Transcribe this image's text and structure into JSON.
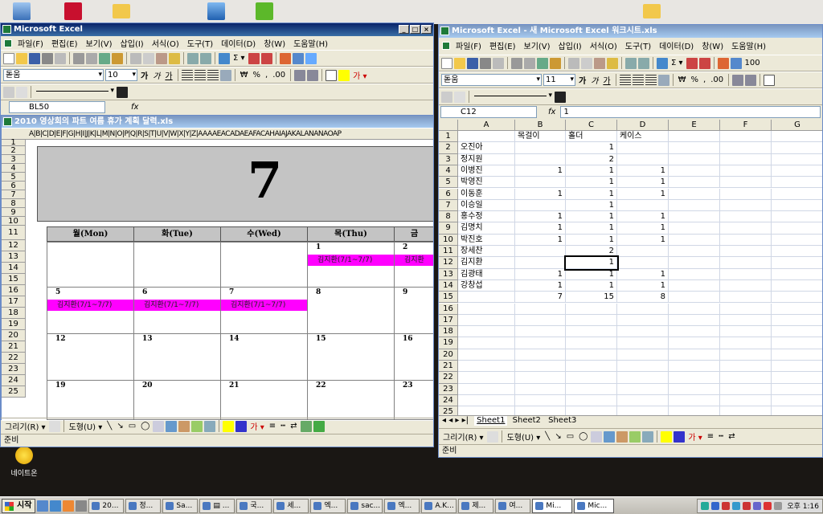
{
  "left_window": {
    "title": "Microsoft Excel",
    "menu": [
      "파일(F)",
      "편집(E)",
      "보기(V)",
      "삽입(I)",
      "서식(O)",
      "도구(T)",
      "데이터(D)",
      "창(W)",
      "도움말(H)"
    ],
    "font_name": "돋움",
    "font_size": "10",
    "name_box": "BL50",
    "fx": "fx",
    "workbook_title": "2010 영상회의 파트 여름 휴가 계획 달력.xls",
    "col_headers": [
      "A",
      "B",
      "C",
      "D",
      "E",
      "F",
      "G",
      "H",
      "I",
      "J",
      "K",
      "L",
      "M",
      "N",
      "O",
      "P",
      "Q",
      "R",
      "S",
      "T",
      "U",
      "V",
      "W",
      "X",
      "Y",
      "Z",
      "AAAAEACADAEAFACAHAIAJAKALANANAOAP"
    ],
    "row_numbers": [
      "1",
      "2",
      "3",
      "4",
      "5",
      "6",
      "7",
      "8",
      "9",
      "10",
      "11",
      "12",
      "13",
      "14",
      "15",
      "16",
      "17",
      "18",
      "19",
      "20",
      "21",
      "22",
      "23",
      "24",
      "25"
    ],
    "calendar": {
      "month": "7",
      "days": [
        "월(Mon)",
        "화(Tue)",
        "수(Wed)",
        "목(Thu)",
        "금"
      ],
      "week1": [
        "",
        "",
        "",
        "1",
        "2"
      ],
      "week2": [
        "5",
        "6",
        "7",
        "8",
        "9"
      ],
      "week3": [
        "12",
        "13",
        "14",
        "15",
        "16"
      ],
      "week4": [
        "19",
        "20",
        "21",
        "22",
        "23"
      ],
      "event_label": "김지환(7/1~7/7)",
      "event_label_short": "김지환"
    },
    "drawing_label": "그리기(R) ▾",
    "shapes_label": "도형(U) ▾",
    "status": "준비"
  },
  "right_window": {
    "title": "Microsoft Excel - 새 Microsoft Excel 워크시트.xls",
    "menu": [
      "파일(F)",
      "편집(E)",
      "보기(V)",
      "삽입(I)",
      "서식(O)",
      "도구(T)",
      "데이터(D)",
      "창(W)",
      "도움말(H)"
    ],
    "font_name": "돋움",
    "font_size": "11",
    "zoom": "100",
    "name_box": "C12",
    "fx": "fx",
    "formula_value": "1",
    "col_headers": [
      "A",
      "B",
      "C",
      "D",
      "E",
      "F",
      "G"
    ],
    "row_numbers": [
      "1",
      "2",
      "3",
      "4",
      "5",
      "6",
      "7",
      "8",
      "9",
      "10",
      "11",
      "12",
      "13",
      "14",
      "15",
      "16",
      "17",
      "18",
      "19",
      "20",
      "21",
      "22",
      "23",
      "24",
      "25"
    ],
    "rows": [
      [
        "",
        "목걸이",
        "홀더",
        "케이스"
      ],
      [
        "오진아",
        "",
        "1",
        ""
      ],
      [
        "정지원",
        "",
        "2",
        ""
      ],
      [
        "이병진",
        "1",
        "1",
        "1"
      ],
      [
        "박영진",
        "",
        "1",
        "1"
      ],
      [
        "이동훈",
        "1",
        "1",
        "1"
      ],
      [
        "이승일",
        "",
        "1",
        ""
      ],
      [
        "홍수정",
        "1",
        "1",
        "1"
      ],
      [
        "김명치",
        "1",
        "1",
        "1"
      ],
      [
        "박진호",
        "1",
        "1",
        "1"
      ],
      [
        "장세찬",
        "",
        "2",
        ""
      ],
      [
        "김지환",
        "",
        "1",
        ""
      ],
      [
        "김광태",
        "1",
        "1",
        "1"
      ],
      [
        "강창섭",
        "1",
        "1",
        "1"
      ],
      [
        "",
        "7",
        "15",
        "8"
      ]
    ],
    "sheet_tabs": [
      "Sheet1",
      "Sheet2",
      "Sheet3"
    ],
    "drawing_label": "그리기(R) ▾",
    "shapes_label": "도형(U) ▾",
    "status": "준비"
  },
  "desktop": {
    "nateon_label": "네이트온"
  },
  "taskbar": {
    "start": "시작",
    "tasks": [
      "20...",
      "정...",
      "Sa...",
      "▤ ...",
      "국...",
      "세...",
      "엑...",
      "sac...",
      "엑...",
      "A.K...",
      "제...",
      "여...",
      "Mi...",
      "Mic..."
    ],
    "active_tasks": [
      12,
      13
    ],
    "clock": "오후 1:16"
  },
  "colors": {
    "event_magenta": "#ff00ff",
    "title_active": "#0a246a",
    "chrome": "#ece9d8"
  }
}
